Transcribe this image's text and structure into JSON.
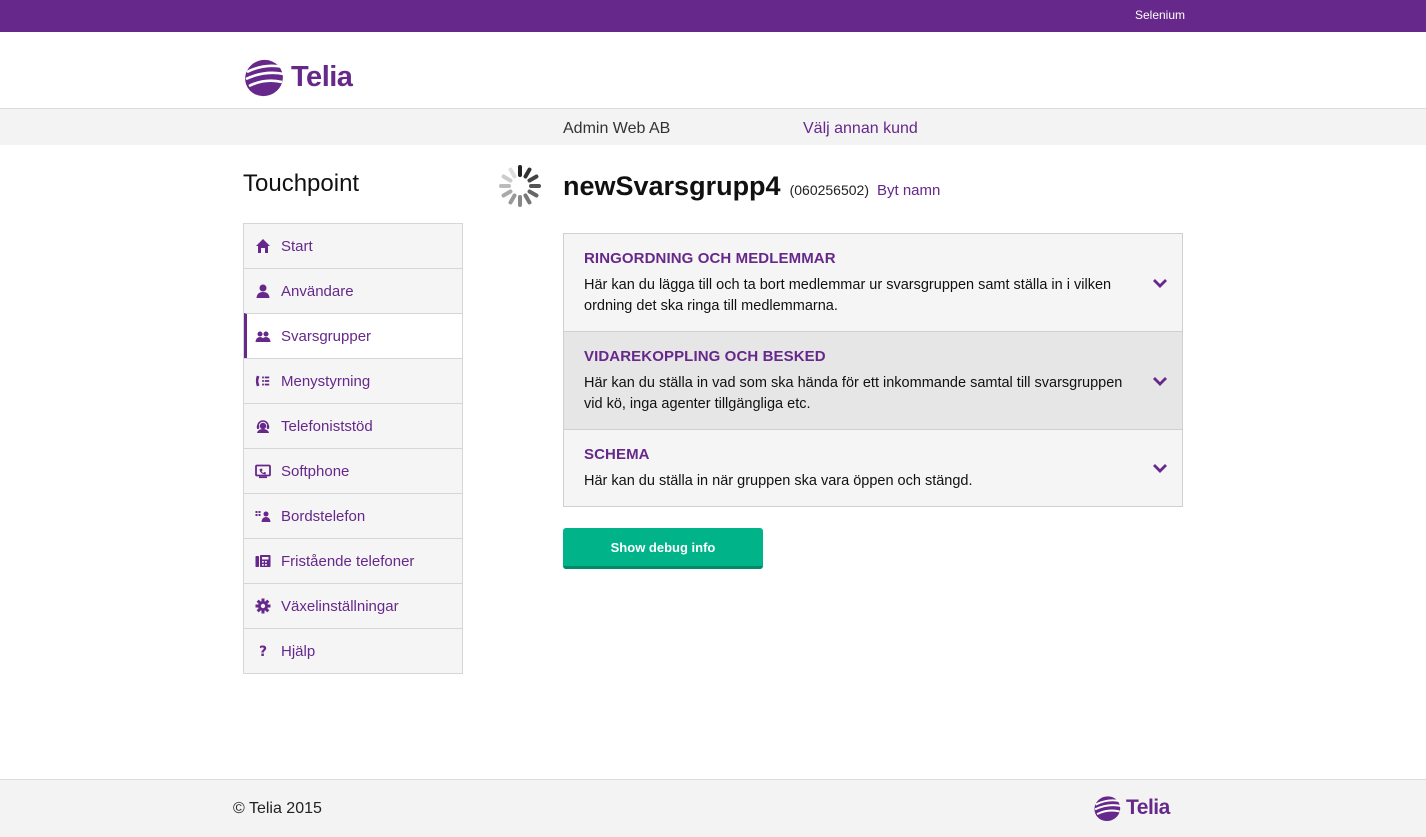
{
  "topbar": {
    "user": "Selenium"
  },
  "brand": {
    "name": "Telia",
    "color": "#66288a"
  },
  "customer": {
    "name": "Admin Web AB",
    "switch_label": "Välj annan kund"
  },
  "app": {
    "title": "Touchpoint"
  },
  "sidebar": {
    "items": [
      {
        "label": "Start",
        "icon": "home-icon"
      },
      {
        "label": "Användare",
        "icon": "user-icon"
      },
      {
        "label": "Svarsgrupper",
        "icon": "group-icon",
        "active": true
      },
      {
        "label": "Menystyrning",
        "icon": "menu-phone-icon"
      },
      {
        "label": "Telefoniststöd",
        "icon": "headset-icon"
      },
      {
        "label": "Softphone",
        "icon": "monitor-icon"
      },
      {
        "label": "Bordstelefon",
        "icon": "desk-phone-icon"
      },
      {
        "label": "Fristående telefoner",
        "icon": "fax-icon"
      },
      {
        "label": "Växelinställningar",
        "icon": "gear-icon"
      },
      {
        "label": "Hjälp",
        "icon": "question-icon"
      }
    ]
  },
  "group": {
    "name": "newSvarsgrupp4",
    "number": "(060256502)",
    "rename_label": "Byt namn"
  },
  "panels": [
    {
      "title": "RINGORDNING OCH MEDLEMMAR",
      "description": "Här kan du lägga till och ta bort medlemmar ur svarsgruppen samt ställa in i vilken ordning det ska ringa till medlemmarna."
    },
    {
      "title": "VIDAREKOPPLING OCH BESKED",
      "description": "Här kan du ställa in vad som ska hända för ett inkommande samtal till svarsgruppen vid kö, inga agenter tillgängliga etc."
    },
    {
      "title": "SCHEMA",
      "description": "Här kan du ställa in när gruppen ska vara öppen och stängd."
    }
  ],
  "debug": {
    "button_label": "Show debug info",
    "color": "#00b388"
  },
  "footer": {
    "copyright": "© Telia 2015"
  }
}
